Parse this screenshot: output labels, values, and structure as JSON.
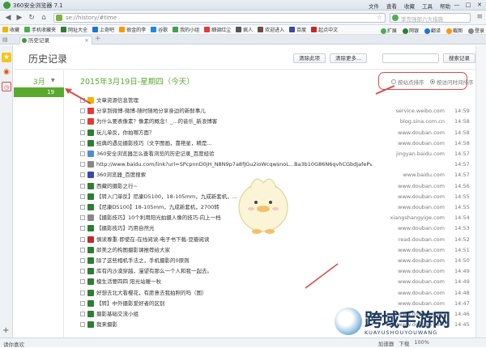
{
  "window": {
    "title": "360安全浏览器 7.1",
    "menu": [
      "文件",
      "查看",
      "收藏",
      "工具",
      "帮助"
    ],
    "controls": [
      "—",
      "□",
      "✕"
    ]
  },
  "navbar": {
    "url": "se://history/#time",
    "search_placeholder": "李克强部六大措施"
  },
  "favorites": [
    {
      "label": "收藏",
      "color": "#f0b400"
    },
    {
      "label": "手机收藏夹",
      "color": "#4caf50"
    },
    {
      "label": "网址大全",
      "color": "#2e7d32"
    },
    {
      "label": "上奇吧",
      "color": "#1976d2"
    },
    {
      "label": "很金的李",
      "color": "#ff9800"
    },
    {
      "label": "谷歌",
      "color": "#1e88e5"
    },
    {
      "label": "我的小组",
      "color": "#43a047"
    },
    {
      "label": "细调红尘",
      "color": "#e53935"
    },
    {
      "label": "疯人",
      "color": "#555555"
    },
    {
      "label": "欢迎进入",
      "color": "#6d4c41"
    },
    {
      "label": "百度",
      "color": "#3949ab"
    },
    {
      "label": "起点中文",
      "color": "#c62828"
    }
  ],
  "fav_right": [
    "扩展",
    "网银",
    "翻译",
    "截图",
    "登录"
  ],
  "tab": {
    "label": "历史记录"
  },
  "history": {
    "title": "历史记录",
    "clear_btn": "清除此项",
    "clear_more_btn": "清除更多...",
    "search_btn": "搜索记录",
    "month": "3月",
    "selected_day": "19",
    "day_heading": "2015年3月19日-星期四（今天）",
    "sort_by_site": "按站点排序",
    "sort_by_time": "按访问时间排序"
  },
  "rows": [
    {
      "title": "文章资源信息管理",
      "domain": "",
      "time": "",
      "icon_color": "#f0b400"
    },
    {
      "title": "分享到微博-微博-随时随地分享身边的新鲜事儿",
      "domain": "service.weibo.com",
      "time": "14:59",
      "icon_color": "#e53935"
    },
    {
      "title": "为什么要表像素？像素的概念！_...的音乐_新浪博客",
      "domain": "blog.sina.com.cn",
      "time": "14:58",
      "icon_color": "#e53935"
    },
    {
      "title": "玩儿单反，你拍哪方面？",
      "domain": "www.douban.com",
      "time": "14:58",
      "icon_color": "#2e7d32"
    },
    {
      "title": "经典的遇见摄影技巧（文字图画，靠艳星，精是...",
      "domain": "www.douban.com",
      "time": "14:58",
      "icon_color": "#2e7d32"
    },
    {
      "title": "360安全浏览器怎么查看浏览的历史记录_百度经验",
      "domain": "jingyan.baidu.com",
      "time": "14:57",
      "icon_color": "#4e8cd6"
    },
    {
      "title": "http://www.baidu.com/link?url=SPcpnnD0jH_N8N9p7a8fJGu2ioWcqwsnoL...Ba3b10G86N6qvhCGbdjafePvjU8uIa7sirQiQhtuscA...",
      "domain": "",
      "time": "14:57",
      "icon_color": "#888888"
    },
    {
      "title": "360浏览器_百度搜索",
      "domain": "www.baidu.com",
      "time": "14:57",
      "icon_color": "#3949ab"
    },
    {
      "title": "西藏的摄影之行~",
      "domain": "www.douban.com",
      "time": "14:56",
      "icon_color": "#2e7d32"
    },
    {
      "title": "【转入门单反】尼康D5100，18-105mm，九成新套机，...",
      "domain": "www.douban.com",
      "time": "14:55",
      "icon_color": "#2e7d32"
    },
    {
      "title": "【尼康D5100】18-105mm，九成新套机，2700转",
      "domain": "www.douban.com",
      "time": "14:55",
      "icon_color": "#2e7d32"
    },
    {
      "title": "【摄影技巧】10个利用阳光拍摄人像的技巧-向上一档",
      "domain": "xiangshangyige.com",
      "time": "14:54",
      "icon_color": "#888888"
    },
    {
      "title": "【摄影技巧】巧用自然光",
      "domain": "www.douban.com",
      "time": "14:53",
      "icon_color": "#2e7d32"
    },
    {
      "title": "慎读尊重-即使在-在线阅读-电子书下载-豆瓣阅读",
      "domain": "read.douban.com",
      "time": "14:52",
      "icon_color": "#c62828"
    },
    {
      "title": "郎美之的构图摄影课推荐给大家",
      "domain": "www.douban.com",
      "time": "14:51",
      "icon_color": "#2e7d32"
    },
    {
      "title": "除了这些相机手法之，手机摄影的0原则",
      "domain": "www.douban.com",
      "time": "14:50",
      "icon_color": "#2e7d32"
    },
    {
      "title": "库有内沙漠穿越，漫望有那么一个人和我一起去。",
      "domain": "www.douban.com",
      "time": "14:49",
      "icon_color": "#2e7d32"
    },
    {
      "title": "模生活要四四 阳光站暖一秋",
      "domain": "www.douban.com",
      "time": "14:49",
      "icon_color": "#2e7d32"
    },
    {
      "title": "好想去北大看樱花，有愿意去我拍照的吗（图）",
      "domain": "www.douban.com",
      "time": "14:48",
      "icon_color": "#2e7d32"
    },
    {
      "title": "【转】中外摄影爱好者的区别",
      "domain": "www.douban.com",
      "time": "14:47",
      "icon_color": "#2e7d32"
    },
    {
      "title": "摄影基础交流小组",
      "domain": "www.douban.com",
      "time": "14:46",
      "icon_color": "#2e7d32"
    },
    {
      "title": "我来摄影",
      "domain": "www.douban.com",
      "time": "14:45",
      "icon_color": "#2e7d32"
    }
  ],
  "statusbar": {
    "left": "请你喜欢",
    "right": [
      "加速器",
      "下载",
      "100%"
    ]
  },
  "watermark": {
    "text": "跨域手游网",
    "sub": "KUAYUSHOUYOUWANG"
  },
  "colors": {
    "accent": "#5aa92f",
    "highlight": "#d94b4b"
  }
}
